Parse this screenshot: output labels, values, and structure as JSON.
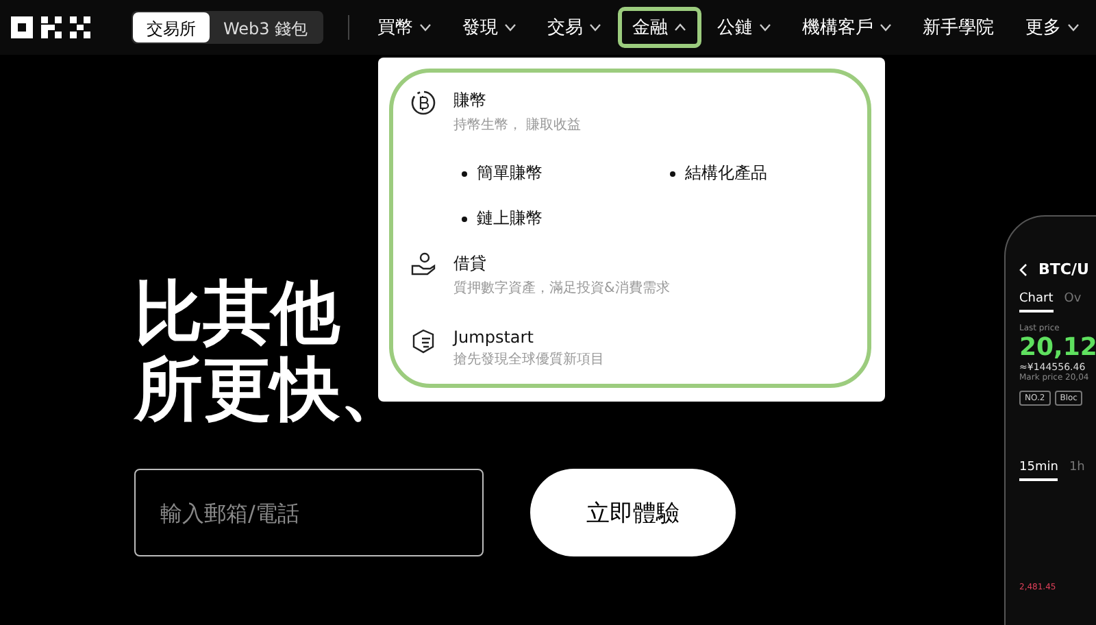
{
  "mode_switch": [
    {
      "label": "交易所",
      "selected": true
    },
    {
      "label": "Web3 錢包",
      "selected": false
    }
  ],
  "nav": [
    {
      "label": "買幣",
      "caret": true,
      "expanded": false
    },
    {
      "label": "發現",
      "caret": true,
      "expanded": false
    },
    {
      "label": "交易",
      "caret": true,
      "expanded": false
    },
    {
      "label": "金融",
      "caret": true,
      "expanded": true
    },
    {
      "label": "公鏈",
      "caret": true,
      "expanded": false
    },
    {
      "label": "機構客戶",
      "caret": true,
      "expanded": false
    },
    {
      "label": "新手學院",
      "caret": false,
      "expanded": false
    },
    {
      "label": "更多",
      "caret": true,
      "expanded": false
    }
  ],
  "dropdown": {
    "items": [
      {
        "kind": "earn",
        "title": "賺幣",
        "subtitle": "持幣生幣， 賺取收益",
        "links": [
          "簡單賺幣",
          "結構化產品",
          "鏈上賺幣"
        ]
      },
      {
        "kind": "loan",
        "title": "借貸",
        "subtitle": "質押數字資產，滿足投資&消費需求"
      },
      {
        "kind": "launch",
        "title": "Jumpstart",
        "subtitle": "搶先發現全球優質新項目"
      }
    ]
  },
  "hero": {
    "lines": [
      "比其他",
      "所更快、"
    ]
  },
  "signup": {
    "placeholder": "輸入郵箱/電話",
    "button": "立即體驗"
  },
  "phone": {
    "pair": "BTC/U",
    "tabs": [
      {
        "label": "Chart",
        "selected": true
      },
      {
        "label": "Ov",
        "selected": false
      }
    ],
    "last_price_label": "Last price",
    "price": "20,12",
    "cny_price": "≈¥144556.46",
    "mark_price": "Mark price 20,04",
    "tags": [
      "NO.2",
      "Bloc"
    ],
    "intervals": [
      {
        "label": "15min",
        "selected": true
      },
      {
        "label": "1h",
        "selected": false
      }
    ],
    "chart_label": "2,481.45"
  }
}
